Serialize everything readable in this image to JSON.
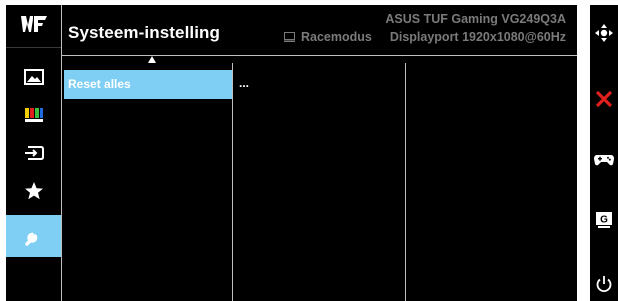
{
  "header": {
    "title": "Systeem-instelling",
    "model": "ASUS TUF Gaming VG249Q3A",
    "mode": "Racemodus",
    "signal": "Displayport 1920x1080@60Hz"
  },
  "sidebar": {
    "items": [
      {
        "icon": "logo-icon"
      },
      {
        "icon": "image-icon"
      },
      {
        "icon": "color-bars-icon"
      },
      {
        "icon": "input-icon"
      },
      {
        "icon": "star-icon"
      },
      {
        "icon": "wrench-icon",
        "selected": true
      }
    ]
  },
  "menu": {
    "items": [
      {
        "label": "Reset alles",
        "selected": true
      }
    ]
  },
  "submenu": {
    "value": "..."
  },
  "right_bar": {
    "buttons": [
      "move-icon",
      "close-icon",
      "gamepad-icon",
      "gameplus-icon",
      "power-icon"
    ]
  },
  "colors": {
    "accent": "#7fcff4",
    "close": "#e0201e",
    "text_dim": "#7a7a7a"
  }
}
